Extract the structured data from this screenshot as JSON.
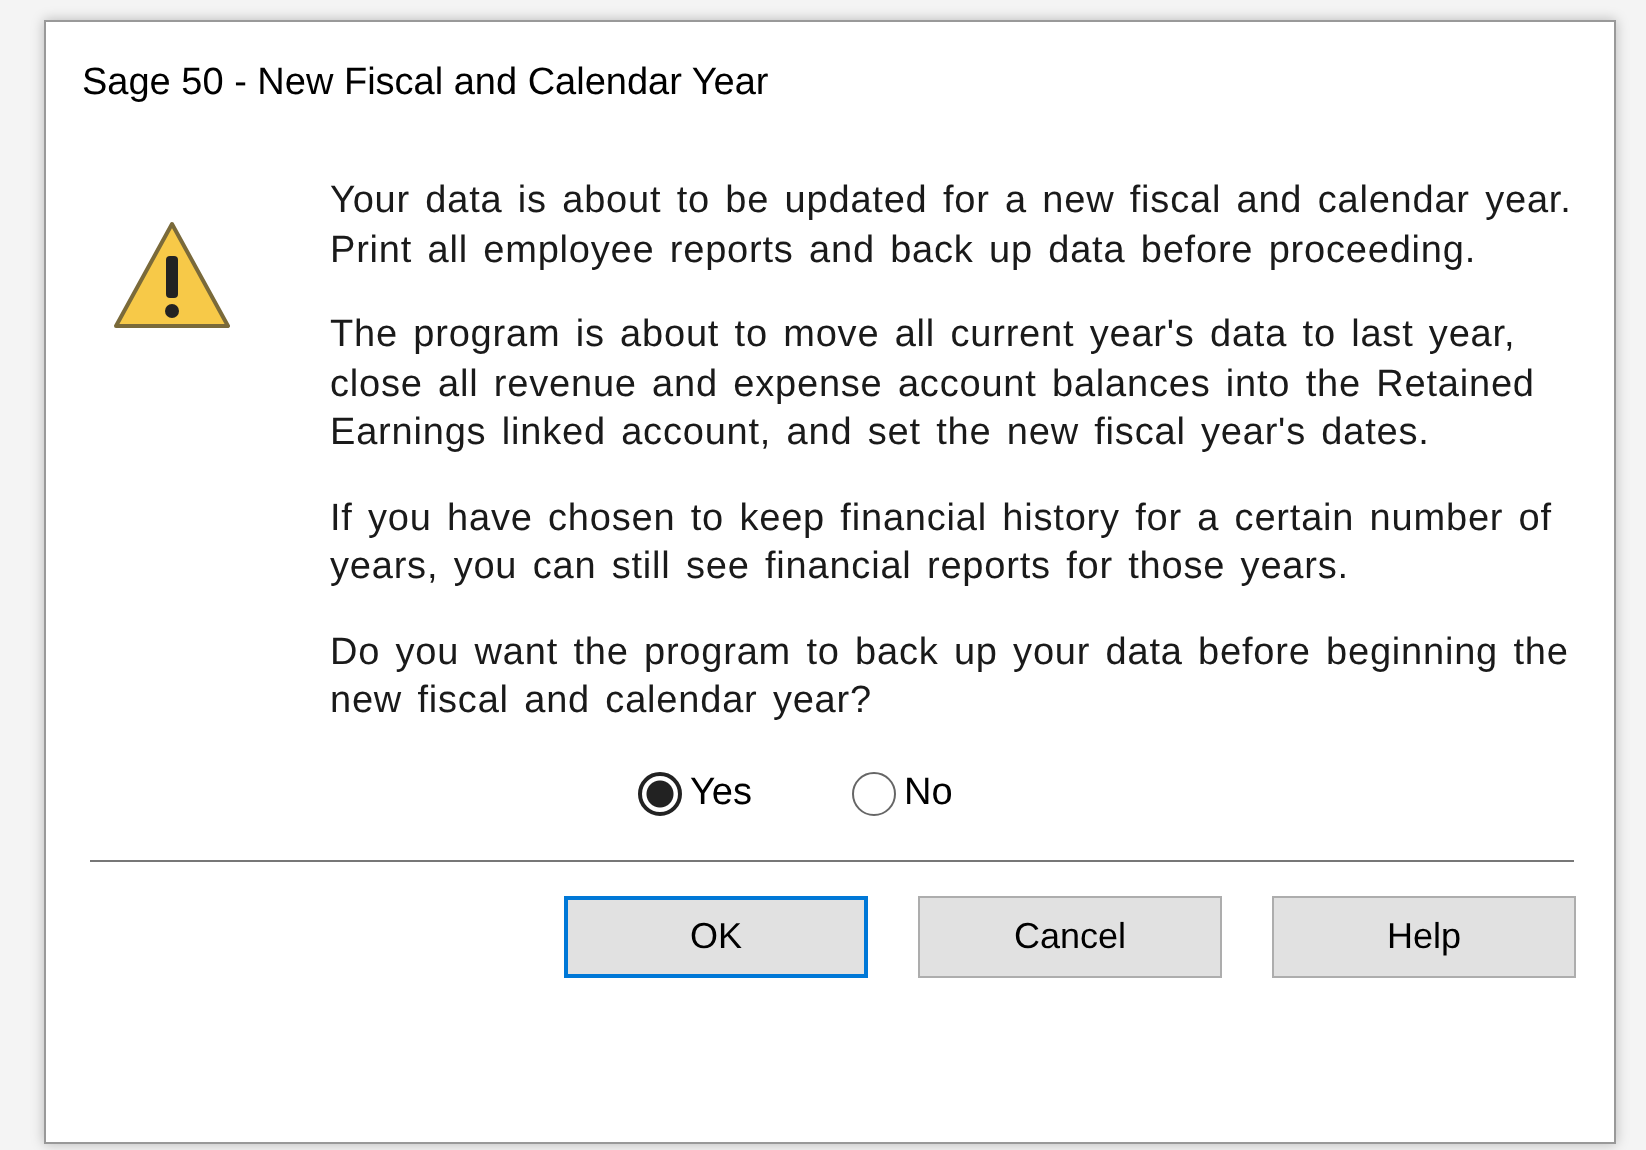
{
  "window": {
    "title": "Sage 50 - New Fiscal and Calendar Year"
  },
  "paragraphs": [
    "Your data is about to be updated for a new fiscal and calendar year. Print all employee reports and back up data before proceeding.",
    "The program is about to move all current year's data to last year, close all revenue and expense account balances into the Retained Earnings linked account, and set the new fiscal year's dates.",
    "If you have chosen to keep financial history for a certain number of years, you can still see financial reports for those years.",
    "Do you want the program to back up your data before beginning the new fiscal and calendar year?"
  ],
  "backup_options": [
    {
      "label": "Yes",
      "selected": true
    },
    {
      "label": "No",
      "selected": false
    }
  ],
  "buttons": [
    {
      "label": "OK",
      "focused": true
    },
    {
      "label": "Cancel",
      "focused": false
    },
    {
      "label": "Help",
      "focused": false
    }
  ]
}
